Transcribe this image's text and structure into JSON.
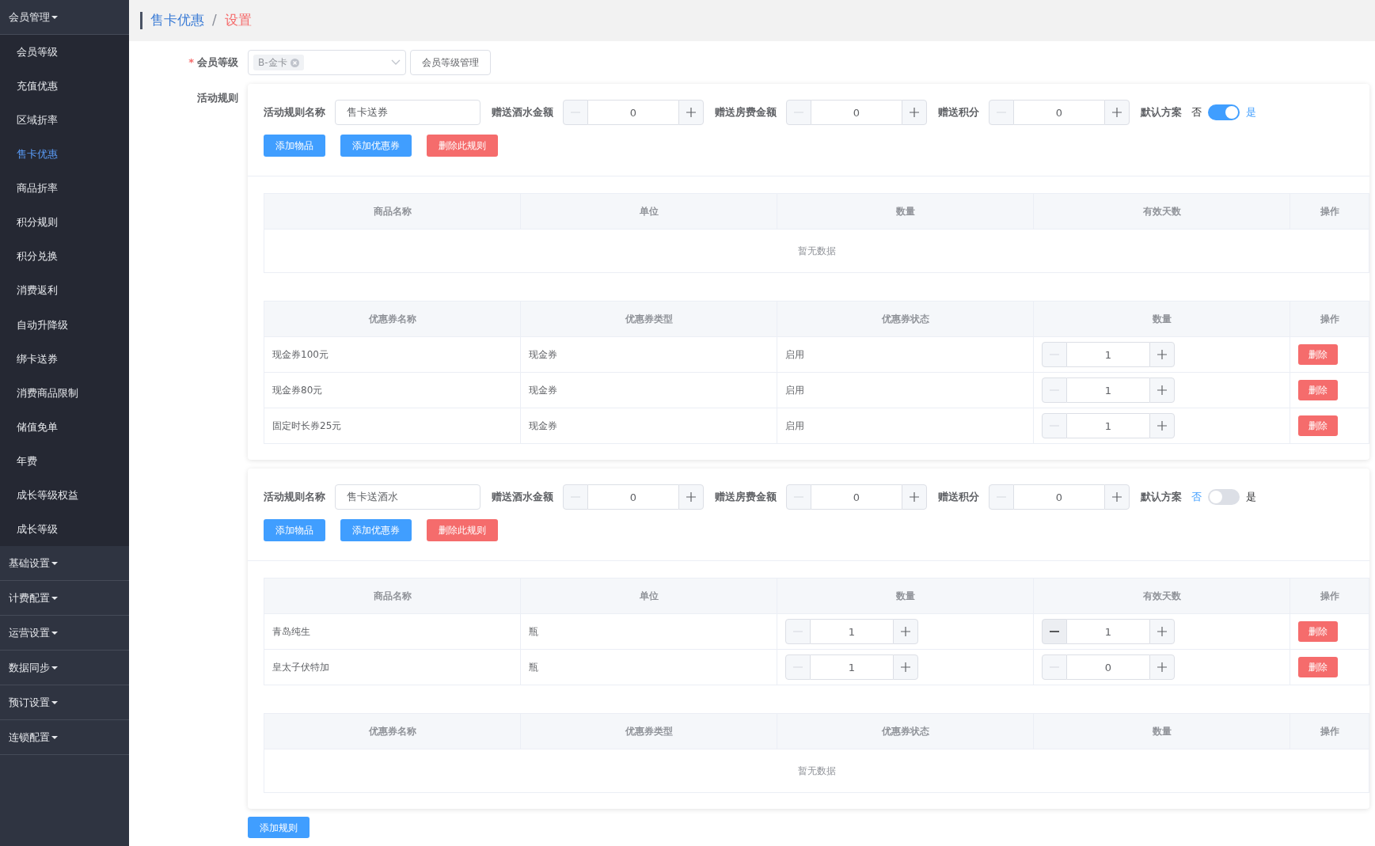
{
  "sidebar": {
    "groups": [
      {
        "label": "会员管理",
        "children": [
          {
            "label": "会员等级",
            "selected": false
          },
          {
            "label": "充值优惠",
            "selected": false
          },
          {
            "label": "区域折率",
            "selected": false
          },
          {
            "label": "售卡优惠",
            "selected": true
          },
          {
            "label": "商品折率",
            "selected": false
          },
          {
            "label": "积分规则",
            "selected": false
          },
          {
            "label": "积分兑换",
            "selected": false
          },
          {
            "label": "消费返利",
            "selected": false
          },
          {
            "label": "自动升降级",
            "selected": false
          },
          {
            "label": "绑卡送券",
            "selected": false
          },
          {
            "label": "消费商品限制",
            "selected": false
          },
          {
            "label": "储值免单",
            "selected": false
          },
          {
            "label": "年费",
            "selected": false
          },
          {
            "label": "成长等级权益",
            "selected": false
          },
          {
            "label": "成长等级",
            "selected": false
          }
        ]
      },
      {
        "label": "基础设置"
      },
      {
        "label": "计费配置"
      },
      {
        "label": "运营设置"
      },
      {
        "label": "数据同步"
      },
      {
        "label": "预订设置"
      },
      {
        "label": "连锁配置"
      }
    ]
  },
  "breadcrumb": [
    "售卡优惠",
    "设置"
  ],
  "breadcrumb_separator": "/",
  "form": {
    "level_label": "会员等级",
    "required": true,
    "required_mark": "*",
    "level_tags": [
      "B-金卡"
    ],
    "manage_button": "会员等级管理",
    "rules_label": "活动规则"
  },
  "rules": [
    {
      "name_label": "活动规则名称",
      "name_value": "售卡送券",
      "steppers": [
        {
          "label": "赠送酒水金额",
          "value": "0",
          "minus_disabled": true
        },
        {
          "label": "赠送房费金额",
          "value": "0",
          "minus_disabled": true
        },
        {
          "label": "赠送积分",
          "value": "0",
          "minus_disabled": true
        }
      ],
      "default_label": "默认方案",
      "off_label": "否",
      "on_label": "是",
      "default_on": true,
      "buttons": [
        {
          "label": "添加物品",
          "kind": "primary"
        },
        {
          "label": "添加优惠券",
          "kind": "primary"
        },
        {
          "label": "删除此规则",
          "kind": "danger"
        }
      ],
      "tables": [
        {
          "columns": [
            "商品名称",
            "单位",
            "数量",
            "有效天数",
            "操作"
          ],
          "empty_text": "暂无数据"
        },
        {
          "columns": [
            "优惠券名称",
            "优惠券类型",
            "优惠券状态",
            "数量",
            "操作"
          ],
          "rows": [
            [
              {
                "kind": "text",
                "text": "现金券100元"
              },
              {
                "kind": "text",
                "text": "现金券"
              },
              {
                "kind": "text",
                "text": "启用"
              },
              {
                "kind": "stepper",
                "value": "1",
                "minus_disabled": true
              },
              {
                "kind": "delete",
                "text": "删除"
              }
            ],
            [
              {
                "kind": "text",
                "text": "现金券80元"
              },
              {
                "kind": "text",
                "text": "现金券"
              },
              {
                "kind": "text",
                "text": "启用"
              },
              {
                "kind": "stepper",
                "value": "1",
                "minus_disabled": true
              },
              {
                "kind": "delete",
                "text": "删除"
              }
            ],
            [
              {
                "kind": "text",
                "text": "固定时长券25元"
              },
              {
                "kind": "text",
                "text": "现金券"
              },
              {
                "kind": "text",
                "text": "启用"
              },
              {
                "kind": "stepper",
                "value": "1",
                "minus_disabled": true
              },
              {
                "kind": "delete",
                "text": "删除"
              }
            ]
          ]
        }
      ]
    },
    {
      "name_label": "活动规则名称",
      "name_value": "售卡送酒水",
      "steppers": [
        {
          "label": "赠送酒水金额",
          "value": "0",
          "minus_disabled": true
        },
        {
          "label": "赠送房费金额",
          "value": "0",
          "minus_disabled": true
        },
        {
          "label": "赠送积分",
          "value": "0",
          "minus_disabled": true
        }
      ],
      "default_label": "默认方案",
      "off_label": "否",
      "on_label": "是",
      "default_on": false,
      "buttons": [
        {
          "label": "添加物品",
          "kind": "primary"
        },
        {
          "label": "添加优惠券",
          "kind": "primary"
        },
        {
          "label": "删除此规则",
          "kind": "danger"
        }
      ],
      "tables": [
        {
          "columns": [
            "商品名称",
            "单位",
            "数量",
            "有效天数",
            "操作"
          ],
          "rows": [
            [
              {
                "kind": "text",
                "text": "青岛纯生"
              },
              {
                "kind": "text",
                "text": "瓶"
              },
              {
                "kind": "stepper",
                "value": "1",
                "minus_disabled": true
              },
              {
                "kind": "stepper",
                "value": "1",
                "minus_disabled": false
              },
              {
                "kind": "delete",
                "text": "删除"
              }
            ],
            [
              {
                "kind": "text",
                "text": "皇太子伏特加"
              },
              {
                "kind": "text",
                "text": "瓶"
              },
              {
                "kind": "stepper",
                "value": "1",
                "minus_disabled": true
              },
              {
                "kind": "stepper",
                "value": "0",
                "minus_disabled": true
              },
              {
                "kind": "delete",
                "text": "删除"
              }
            ]
          ]
        },
        {
          "columns": [
            "优惠券名称",
            "优惠券类型",
            "优惠券状态",
            "数量",
            "操作"
          ],
          "empty_text": "暂无数据"
        }
      ]
    }
  ],
  "add_rule_button": "添加规则"
}
